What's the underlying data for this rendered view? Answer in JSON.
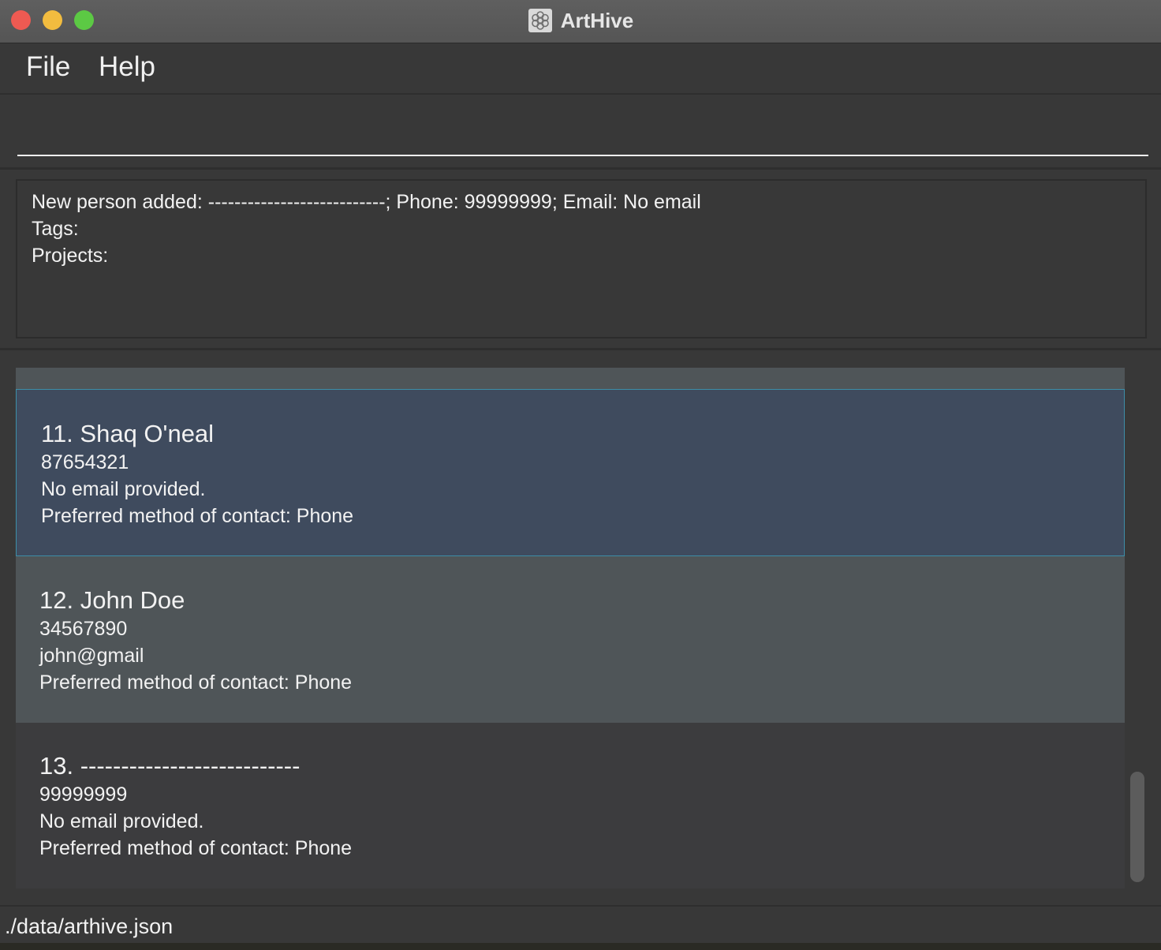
{
  "window": {
    "title": "ArtHive",
    "icon": "flower-pattern-icon"
  },
  "menu": {
    "file_label": "File",
    "help_label": "Help"
  },
  "command_box": {
    "value": "",
    "placeholder": ""
  },
  "result": {
    "lines": [
      "New person added: ---------------------------; Phone: 99999999; Email: No email",
      "Tags:",
      "Projects:"
    ]
  },
  "persons": [
    {
      "name": "11. Shaq O'neal",
      "phone": "87654321",
      "email": "No email provided.",
      "contact": "Preferred method of contact: Phone",
      "selected": true
    },
    {
      "name": "12. John Doe",
      "phone": "34567890",
      "email": "john@gmail",
      "contact": "Preferred method of contact: Phone",
      "selected": false
    },
    {
      "name": "13. ---------------------------",
      "phone": "99999999",
      "email": "No email provided.",
      "contact": "Preferred method of contact: Phone",
      "selected": false
    }
  ],
  "status_bar": {
    "file_path": "./data/arthive.json"
  },
  "colors": {
    "window_bg": "#383838",
    "selected_card_bg": "#3f4b5e",
    "selected_card_border": "#3d8ea8",
    "alt_card_bg": "#4f5558",
    "text": "#f2f2f2",
    "traffic_close": "#ee5a52",
    "traffic_minimize": "#f2bc3f",
    "traffic_maximize": "#5cc944"
  }
}
